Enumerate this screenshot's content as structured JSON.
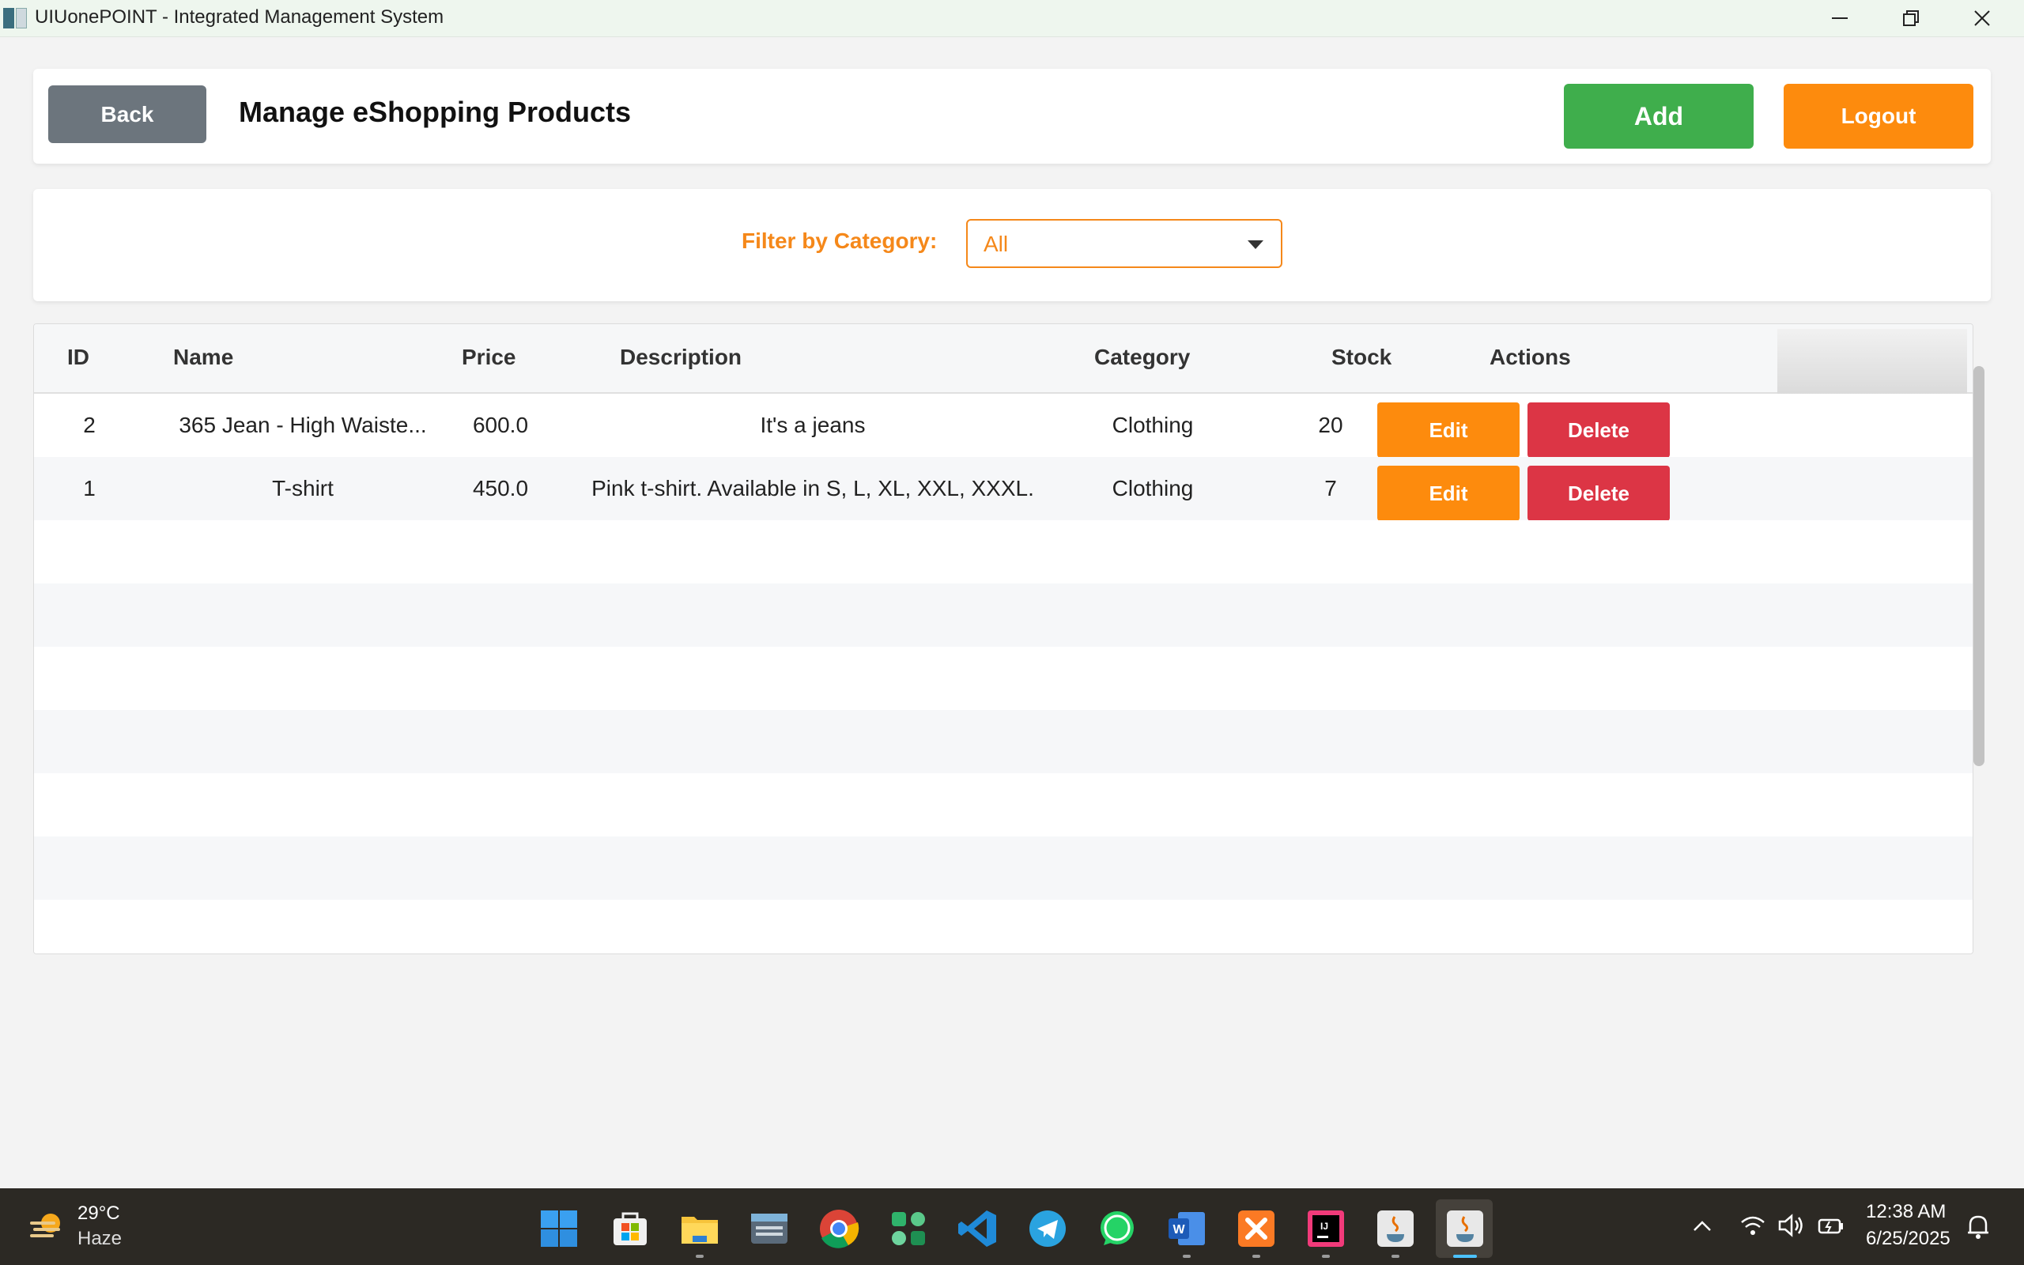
{
  "window": {
    "title": "UIUonePOINT - Integrated Management System"
  },
  "header": {
    "back_label": "Back",
    "page_title": "Manage eShopping Products",
    "add_label": "Add",
    "logout_label": "Logout"
  },
  "filter": {
    "label": "Filter by Category:",
    "selected": "All"
  },
  "table": {
    "columns": [
      "ID",
      "Name",
      "Price",
      "Description",
      "Category",
      "Stock",
      "Actions"
    ],
    "rows": [
      {
        "id": "2",
        "name": "365 Jean - High Waiste...",
        "price": "600.0",
        "description": "It's a jeans",
        "category": "Clothing",
        "stock": "20",
        "edit": "Edit",
        "delete": "Delete"
      },
      {
        "id": "1",
        "name": "T-shirt",
        "price": "450.0",
        "description": "Pink t-shirt. Available in S, L, XL, XXL, XXXL.",
        "category": "Clothing",
        "stock": "7",
        "edit": "Edit",
        "delete": "Delete"
      }
    ]
  },
  "taskbar": {
    "weather_temp": "29°C",
    "weather_desc": "Haze",
    "time": "12:38 AM",
    "date": "6/25/2025",
    "apps": [
      "start-icon",
      "store-icon",
      "file-explorer-icon",
      "keyboard-app-icon",
      "chrome-icon",
      "green-app-icon",
      "vscode-icon",
      "telegram-icon",
      "whatsapp-icon",
      "word-icon",
      "xampp-icon",
      "intellij-icon",
      "java-icon",
      "java-icon-active"
    ]
  },
  "colors": {
    "orange": "#fd8b0d",
    "green": "#3fae4c",
    "red": "#dc3545",
    "gray_button": "#6c757d"
  }
}
